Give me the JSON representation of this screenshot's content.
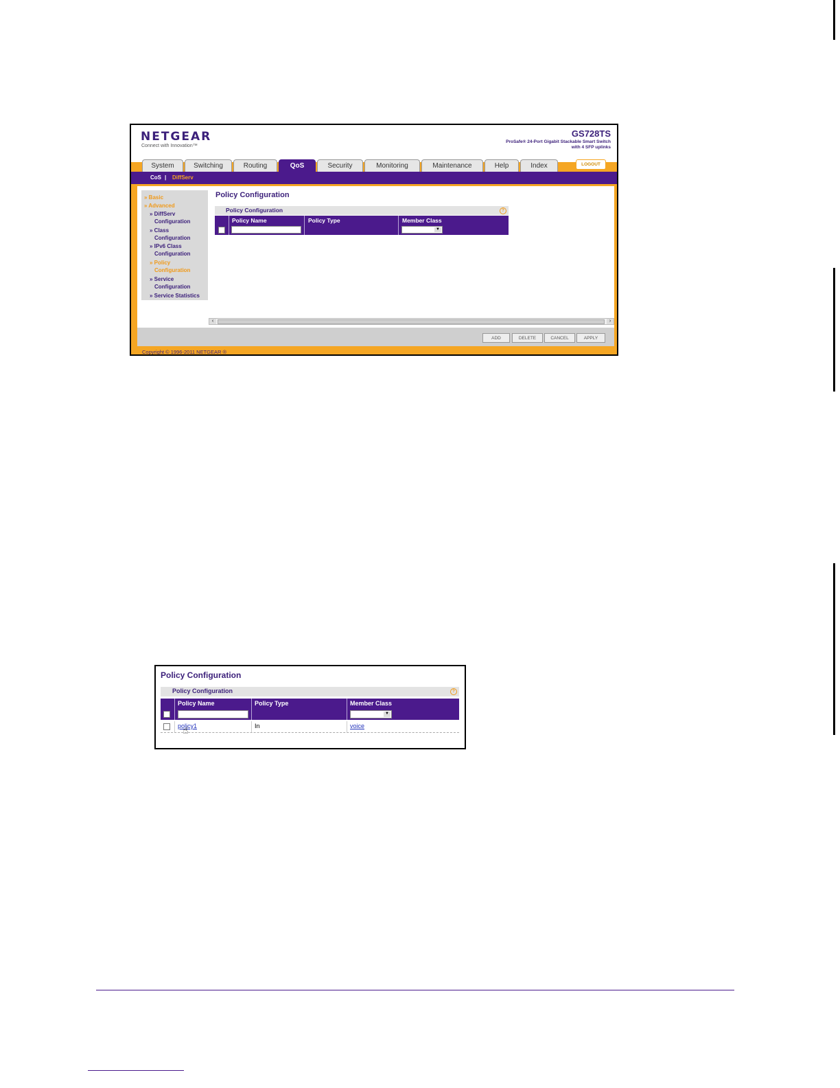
{
  "header": {
    "brand": "NETGEAR",
    "tagline": "Connect with Innovation™",
    "model": "GS728TS",
    "model_desc_line1": "ProSafe® 24-Port Gigabit Stackable Smart Switch",
    "model_desc_line2": "with 4 SFP uplinks",
    "logout_label": "LOGOUT"
  },
  "tabs": [
    {
      "label": "System"
    },
    {
      "label": "Switching"
    },
    {
      "label": "Routing"
    },
    {
      "label": "QoS"
    },
    {
      "label": "Security"
    },
    {
      "label": "Monitoring"
    },
    {
      "label": "Maintenance"
    },
    {
      "label": "Help"
    },
    {
      "label": "Index"
    }
  ],
  "subnav": {
    "cos": "CoS",
    "sep": "|",
    "diffserv": "DiffServ"
  },
  "sidebar": {
    "basic": "» Basic",
    "advanced": "» Advanced",
    "items": [
      {
        "line1": "» DiffServ",
        "line2": "Configuration"
      },
      {
        "line1": "» Class",
        "line2": "Configuration"
      },
      {
        "line1": "» IPv6 Class",
        "line2": "Configuration"
      },
      {
        "line1": "» Policy",
        "line2": "Configuration"
      },
      {
        "line1": "» Service",
        "line2": "Configuration"
      },
      {
        "line1": "» Service Statistics",
        "line2": ""
      }
    ]
  },
  "main": {
    "page_title": "Policy Configuration",
    "panel_title": "Policy Configuration",
    "help_icon_glyph": "?",
    "columns": [
      "Policy Name",
      "Policy Type",
      "Member Class"
    ],
    "policy_name_value": "",
    "member_class_value": ""
  },
  "buttons": {
    "add": "ADD",
    "delete": "DELETE",
    "cancel": "CANCEL",
    "apply": "APPLY"
  },
  "footer": {
    "copyright": "Copyright © 1996-2011 NETGEAR ®"
  },
  "second_screenshot": {
    "page_title": "Policy Configuration",
    "panel_title": "Policy Configuration",
    "columns": [
      "Policy Name",
      "Policy Type",
      "Member Class"
    ],
    "rows": [
      {
        "policy_name": "policy1",
        "policy_type": "In",
        "member_class": "voice"
      }
    ]
  },
  "colors": {
    "purple": "#4b1a8c",
    "orange": "#f5a623",
    "link": "#2233bb"
  },
  "icons": {
    "help": "help-icon",
    "hand_cursor": "hand-cursor-icon",
    "dropdown": "chevron-down-icon"
  }
}
